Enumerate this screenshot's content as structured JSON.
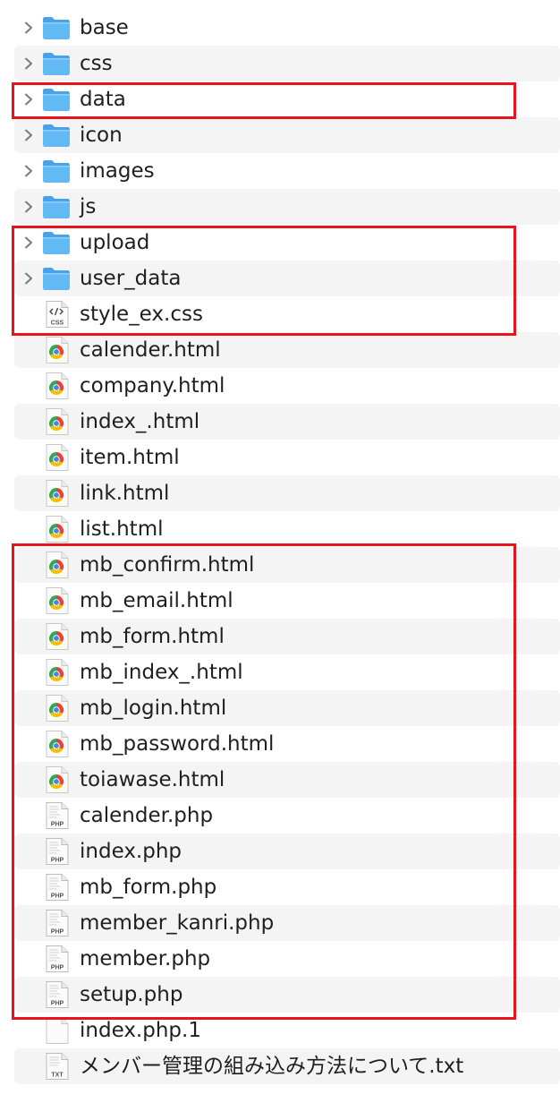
{
  "files": [
    {
      "name": "base",
      "kind": "folder",
      "icon": "folder-icon",
      "expandable": true
    },
    {
      "name": "css",
      "kind": "folder",
      "icon": "folder-icon",
      "expandable": true
    },
    {
      "name": "data",
      "kind": "folder",
      "icon": "folder-icon",
      "expandable": true
    },
    {
      "name": "icon",
      "kind": "folder",
      "icon": "folder-icon",
      "expandable": true
    },
    {
      "name": "images",
      "kind": "folder",
      "icon": "folder-icon",
      "expandable": true
    },
    {
      "name": "js",
      "kind": "folder",
      "icon": "folder-icon",
      "expandable": true
    },
    {
      "name": "upload",
      "kind": "folder",
      "icon": "folder-icon",
      "expandable": true
    },
    {
      "name": "user_data",
      "kind": "folder",
      "icon": "folder-icon",
      "expandable": true
    },
    {
      "name": "style_ex.css",
      "kind": "css",
      "icon": "css-file-icon",
      "badge": "CSS",
      "expandable": false
    },
    {
      "name": "calender.html",
      "kind": "html",
      "icon": "chrome-html-file-icon",
      "expandable": false
    },
    {
      "name": "company.html",
      "kind": "html",
      "icon": "chrome-html-file-icon",
      "expandable": false
    },
    {
      "name": "index_.html",
      "kind": "html",
      "icon": "chrome-html-file-icon",
      "expandable": false
    },
    {
      "name": "item.html",
      "kind": "html",
      "icon": "chrome-html-file-icon",
      "expandable": false
    },
    {
      "name": "link.html",
      "kind": "html",
      "icon": "chrome-html-file-icon",
      "expandable": false
    },
    {
      "name": "list.html",
      "kind": "html",
      "icon": "chrome-html-file-icon",
      "expandable": false
    },
    {
      "name": "mb_confirm.html",
      "kind": "html",
      "icon": "chrome-html-file-icon",
      "expandable": false
    },
    {
      "name": "mb_email.html",
      "kind": "html",
      "icon": "chrome-html-file-icon",
      "expandable": false
    },
    {
      "name": "mb_form.html",
      "kind": "html",
      "icon": "chrome-html-file-icon",
      "expandable": false
    },
    {
      "name": "mb_index_.html",
      "kind": "html",
      "icon": "chrome-html-file-icon",
      "expandable": false
    },
    {
      "name": "mb_login.html",
      "kind": "html",
      "icon": "chrome-html-file-icon",
      "expandable": false
    },
    {
      "name": "mb_password.html",
      "kind": "html",
      "icon": "chrome-html-file-icon",
      "expandable": false
    },
    {
      "name": "toiawase.html",
      "kind": "html",
      "icon": "chrome-html-file-icon",
      "expandable": false
    },
    {
      "name": "calender.php",
      "kind": "php",
      "icon": "php-file-icon",
      "badge": "PHP",
      "expandable": false
    },
    {
      "name": "index.php",
      "kind": "php",
      "icon": "php-file-icon",
      "badge": "PHP",
      "expandable": false
    },
    {
      "name": "mb_form.php",
      "kind": "php",
      "icon": "php-file-icon",
      "badge": "PHP",
      "expandable": false
    },
    {
      "name": "member_kanri.php",
      "kind": "php",
      "icon": "php-file-icon",
      "badge": "PHP",
      "expandable": false
    },
    {
      "name": "member.php",
      "kind": "php",
      "icon": "php-file-icon",
      "badge": "PHP",
      "expandable": false
    },
    {
      "name": "setup.php",
      "kind": "php",
      "icon": "php-file-icon",
      "badge": "PHP",
      "expandable": false
    },
    {
      "name": "index.php.1",
      "kind": "blank",
      "icon": "blank-file-icon",
      "expandable": false
    },
    {
      "name": "メンバー管理の組み込み方法について.txt",
      "kind": "txt",
      "icon": "txt-file-icon",
      "badge": "TXT",
      "expandable": false
    }
  ],
  "colors": {
    "highlight": "#e8141b",
    "folder": "#5bb3f2",
    "row_stripe": "#f4f4f5",
    "text": "#1f1f1f"
  }
}
